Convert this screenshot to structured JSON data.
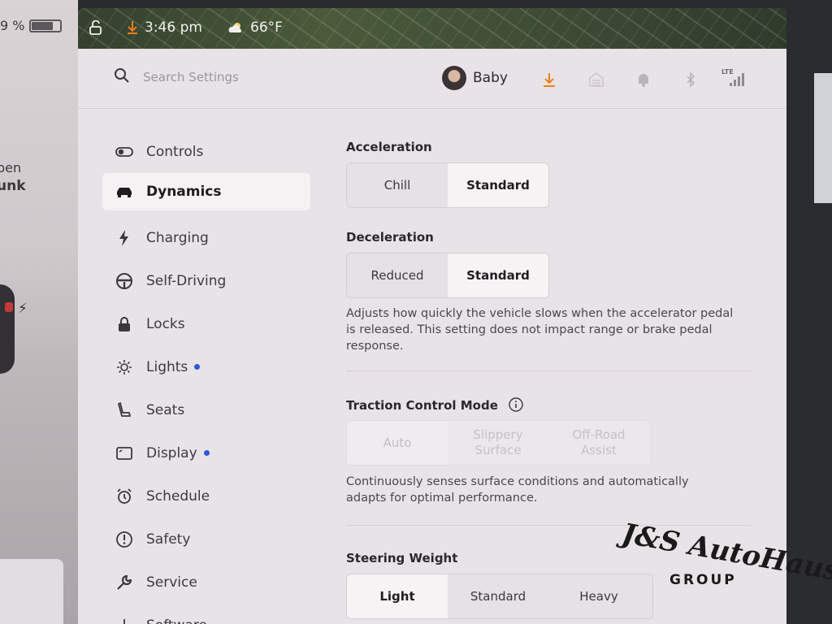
{
  "status": {
    "battery_percent": "9 %",
    "time": "3:46 pm",
    "temperature": "66°F"
  },
  "car_panel": {
    "trunk_line1": "pen",
    "trunk_line2": "unk"
  },
  "header": {
    "search_placeholder": "Search Settings",
    "profile_name": "Baby",
    "icons": [
      "download-icon",
      "garage-icon",
      "bell-icon",
      "bluetooth-icon",
      "lte-signal-icon"
    ],
    "lte_label": "LTE"
  },
  "sidebar": {
    "items": [
      {
        "label": "Controls",
        "icon": "toggle-icon",
        "active": false,
        "dot": false
      },
      {
        "label": "Dynamics",
        "icon": "car-icon",
        "active": true,
        "dot": false
      },
      {
        "label": "Charging",
        "icon": "bolt-icon",
        "active": false,
        "dot": false
      },
      {
        "label": "Self-Driving",
        "icon": "steering-wheel-icon",
        "active": false,
        "dot": false
      },
      {
        "label": "Locks",
        "icon": "lock-icon",
        "active": false,
        "dot": false
      },
      {
        "label": "Lights",
        "icon": "sun-icon",
        "active": false,
        "dot": true
      },
      {
        "label": "Seats",
        "icon": "seat-icon",
        "active": false,
        "dot": false
      },
      {
        "label": "Display",
        "icon": "display-icon",
        "active": false,
        "dot": true
      },
      {
        "label": "Schedule",
        "icon": "alarm-clock-icon",
        "active": false,
        "dot": false
      },
      {
        "label": "Safety",
        "icon": "alert-circle-icon",
        "active": false,
        "dot": false
      },
      {
        "label": "Service",
        "icon": "wrench-icon",
        "active": false,
        "dot": false
      },
      {
        "label": "Software",
        "icon": "download-arrow-icon",
        "active": false,
        "dot": false
      }
    ]
  },
  "main": {
    "acceleration": {
      "title": "Acceleration",
      "options": [
        "Chill",
        "Standard"
      ],
      "selected": "Standard"
    },
    "deceleration": {
      "title": "Deceleration",
      "options": [
        "Reduced",
        "Standard"
      ],
      "selected": "Standard",
      "description": "Adjusts how quickly the vehicle slows when the accelerator pedal is released. This setting does not impact range or brake pedal response."
    },
    "traction": {
      "title": "Traction Control Mode",
      "options": [
        "Auto",
        "Slippery Surface",
        "Off-Road Assist"
      ],
      "selected": "Auto",
      "disabled": true,
      "description": "Continuously senses surface conditions and automatically adapts for optimal performance."
    },
    "steering": {
      "title": "Steering Weight",
      "options": [
        "Light",
        "Standard",
        "Heavy"
      ],
      "selected": "Light"
    }
  },
  "watermark": {
    "script": "J&S AutoHaus",
    "group": "GROUP"
  },
  "colors": {
    "accent_orange": "#e8811f",
    "dot_blue": "#2f5ad0",
    "pane_bg": "#e8e3e6"
  }
}
